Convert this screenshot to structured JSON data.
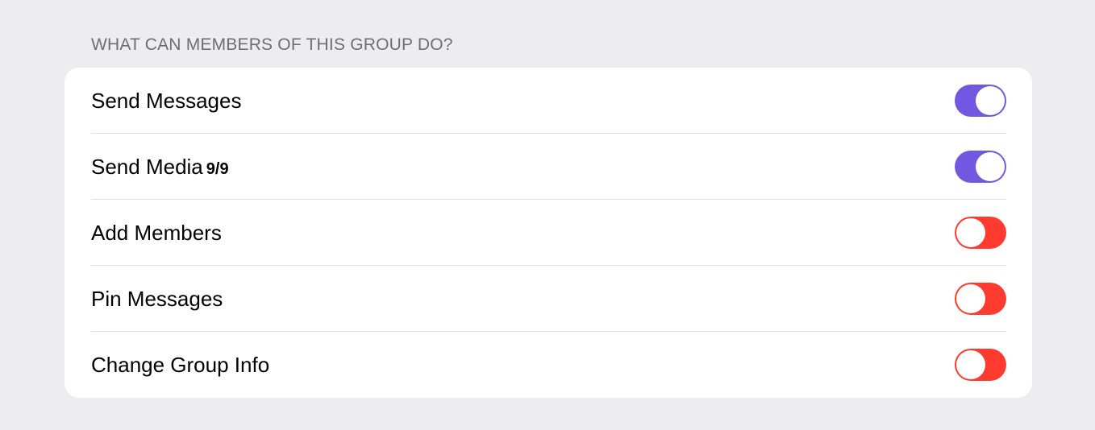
{
  "section": {
    "header": "WHAT CAN MEMBERS OF THIS GROUP DO?"
  },
  "permissions": [
    {
      "label": "Send Messages",
      "badge": "",
      "enabled": true
    },
    {
      "label": "Send Media",
      "badge": "9/9",
      "enabled": true
    },
    {
      "label": "Add Members",
      "badge": "",
      "enabled": false
    },
    {
      "label": "Pin Messages",
      "badge": "",
      "enabled": false
    },
    {
      "label": "Change Group Info",
      "badge": "",
      "enabled": false
    }
  ],
  "colors": {
    "background": "#ececf1",
    "toggle_on": "#7059e0",
    "toggle_off": "#ff3b30",
    "header_text": "#6d6d72"
  }
}
